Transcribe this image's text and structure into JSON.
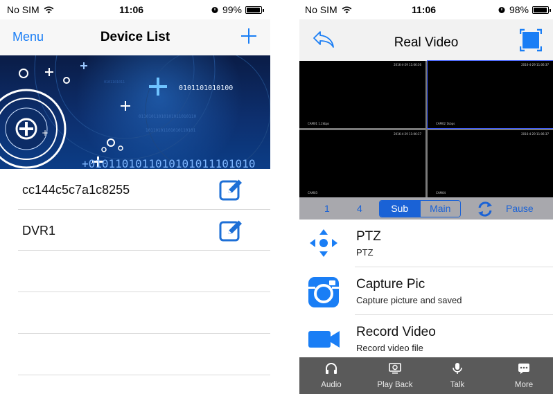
{
  "left_screen": {
    "status": {
      "carrier": "No SIM",
      "time": "11:06",
      "battery": "99%",
      "battery_level": 0.99
    },
    "nav": {
      "menu": "Menu",
      "title": "Device List",
      "add_icon": "plus-icon"
    },
    "banner": {
      "binary_1": "0101101010100",
      "binary_2": "+0101101011010101011101010"
    },
    "devices": [
      {
        "name": "cc144c5c7a1c8255",
        "icon": "edit-icon"
      },
      {
        "name": "DVR1",
        "icon": "edit-icon"
      }
    ],
    "empty_rows": 3
  },
  "right_screen": {
    "status": {
      "carrier": "No SIM",
      "time": "11:06",
      "battery": "98%",
      "battery_level": 0.98
    },
    "nav": {
      "title": "Real Video",
      "back_icon": "back-arrow-icon",
      "fullscreen_icon": "fullscreen-icon"
    },
    "video": {
      "cells": [
        {
          "timestamp": "2016-4-29 11:06:36",
          "camera": "CAM01 1.2kbps",
          "selected": false
        },
        {
          "timestamp": "2016-4-29 11:06:37",
          "camera": "CAM02 1kbps",
          "selected": true
        },
        {
          "timestamp": "2016-4-29 11:06:37",
          "camera": "CAM03",
          "selected": false
        },
        {
          "timestamp": "2016-4-29 11:06:37",
          "camera": "CAM04",
          "selected": false
        }
      ]
    },
    "controls": {
      "one": "1",
      "four": "4",
      "sub": "Sub",
      "main": "Main",
      "refresh_icon": "refresh-icon",
      "pause": "Pause"
    },
    "functions": [
      {
        "title": "PTZ",
        "subtitle": "PTZ",
        "icon": "ptz-arrows-icon",
        "color": "#1a7ef5"
      },
      {
        "title": "Capture Pic",
        "subtitle": "Capture picture and saved",
        "icon": "camera-icon",
        "color": "#1a7ef5"
      },
      {
        "title": "Record Video",
        "subtitle": "Record video file",
        "icon": "video-camera-icon",
        "color": "#1a7ef5"
      }
    ],
    "tabs": [
      {
        "label": "Audio",
        "icon": "headphones-icon"
      },
      {
        "label": "Play Back",
        "icon": "playback-icon"
      },
      {
        "label": "Talk",
        "icon": "microphone-icon"
      },
      {
        "label": "More",
        "icon": "more-icon"
      }
    ]
  },
  "colors": {
    "accent": "#1a7ef5",
    "control_blue": "#1a62d6",
    "tabbar": "#5a5a5a"
  }
}
